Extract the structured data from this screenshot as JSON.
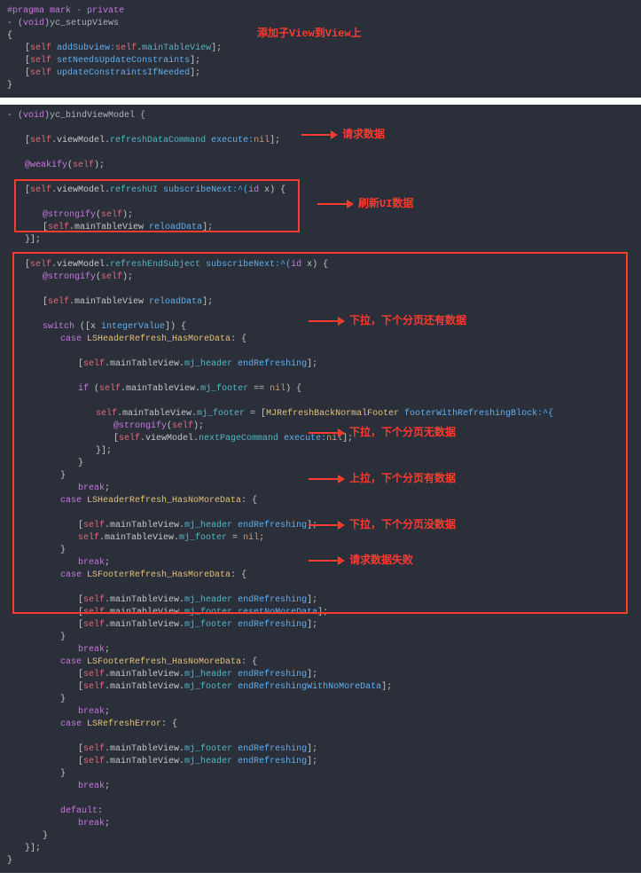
{
  "block1": {
    "pragma": "#pragma mark - private",
    "sig_dash": "- (",
    "sig_void": "void",
    "sig_name": ")yc_setupViews",
    "l1_self": "self",
    "l1_method": "addSubview:",
    "l1_prop": "mainTableView",
    "l2_self": "self",
    "l2_method": "setNeedsUpdateConstraints",
    "l3_self": "self",
    "l3_method": "updateConstraintsIfNeeded",
    "annotation": "添加子View到View上"
  },
  "block2": {
    "sig_dash": "- (",
    "sig_void": "void",
    "sig_name": ")yc_bindViewModel {",
    "l_exec": {
      "self": "self",
      "vm": ".viewModel.",
      "cmd": "refreshDataCommand",
      "exec": " execute:",
      "nil": "nil"
    },
    "weakify": "@weakify",
    "weakify_arg": "self",
    "refreshUI": {
      "self": "self",
      "vm": ".viewModel.",
      "prop": "refreshUI",
      "sub": " subscribeNext:^(",
      "id": "id",
      "x": " x) {"
    },
    "strongify": "@strongify",
    "strongify_arg": "self",
    "reload": {
      "self": "self",
      "tbl": ".mainTableView",
      "reload": " reloadData"
    },
    "refreshEnd": {
      "self": "self",
      "vm": ".viewModel.",
      "prop": "refreshEndSubject",
      "sub": " subscribeNext:^(",
      "id": "id",
      "x": " x) {"
    },
    "switch_kw": "switch",
    "switch_expr": " ([x ",
    "intval": "integerValue",
    "switch_close": "]) {",
    "case_kw": "case",
    "default_kw": "default",
    "break_kw": "break",
    "cases": {
      "c1": "LSHeaderRefresh_HasMoreData",
      "c2": "LSHeaderRefresh_HasNoMoreData",
      "c3": "LSFooterRefresh_HasMoreData",
      "c4": "LSFooterRefresh_HasNoMoreData",
      "c5": "LSRefreshError"
    },
    "endRefreshing": "endRefreshing",
    "resetNoMoreData": "resetNoMoreData",
    "endRefreshingWithNoMoreData": "endRefreshingWithNoMoreData",
    "mj_header": "mj_header",
    "mj_footer": "mj_footer",
    "if_kw": "if",
    "nil_kw": "nil",
    "footer_assign": "MJRefreshBackNormalFooter",
    "footer_block": " footerWithRefreshingBlock:^{",
    "nextPage": "nextPageCommand",
    "annotations": {
      "a1": "请求数据",
      "a2": "刷新UI数据",
      "a3": "下拉，下个分页还有数据",
      "a4": "下拉，下个分页无数据",
      "a5": "上拉，下个分页有数据",
      "a6": "下拉，下个分页没数据",
      "a7": "请求数据失败"
    }
  }
}
